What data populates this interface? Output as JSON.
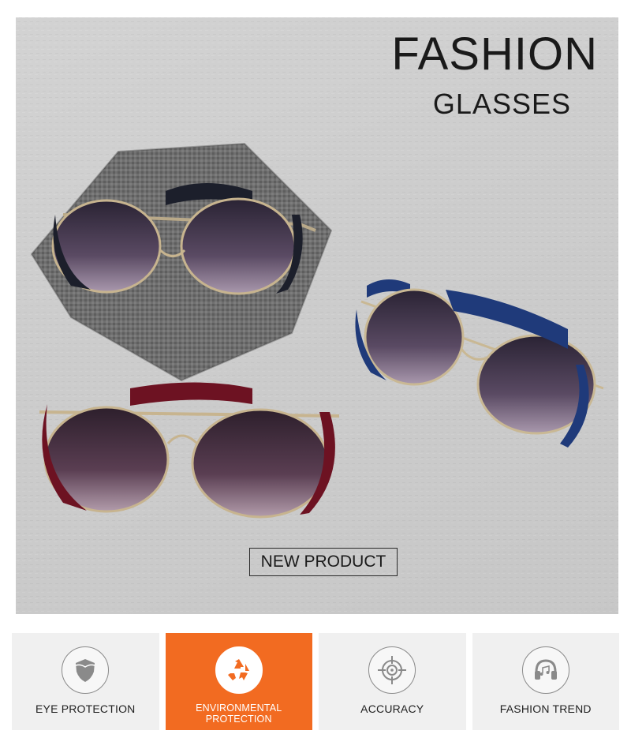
{
  "hero": {
    "title": "FASHION",
    "subtitle": "GLASSES",
    "badge": "NEW PRODUCT"
  },
  "features": [
    {
      "label": "EYE PROTECTION",
      "icon": "shield-icon",
      "active": false
    },
    {
      "label": "ENVIRONMENTAL PROTECTION",
      "icon": "recycle-icon",
      "active": true
    },
    {
      "label": "ACCURACY",
      "icon": "crosshair-icon",
      "active": false
    },
    {
      "label": "FASHION TREND",
      "icon": "headphones-icon",
      "active": false
    }
  ],
  "colors": {
    "accent": "#f26b21",
    "panel": "#f0f0f0",
    "frame_black": "#1c1f2b",
    "frame_blue": "#1f3a7a",
    "frame_red": "#6d1222",
    "lens": "#3e3247"
  }
}
